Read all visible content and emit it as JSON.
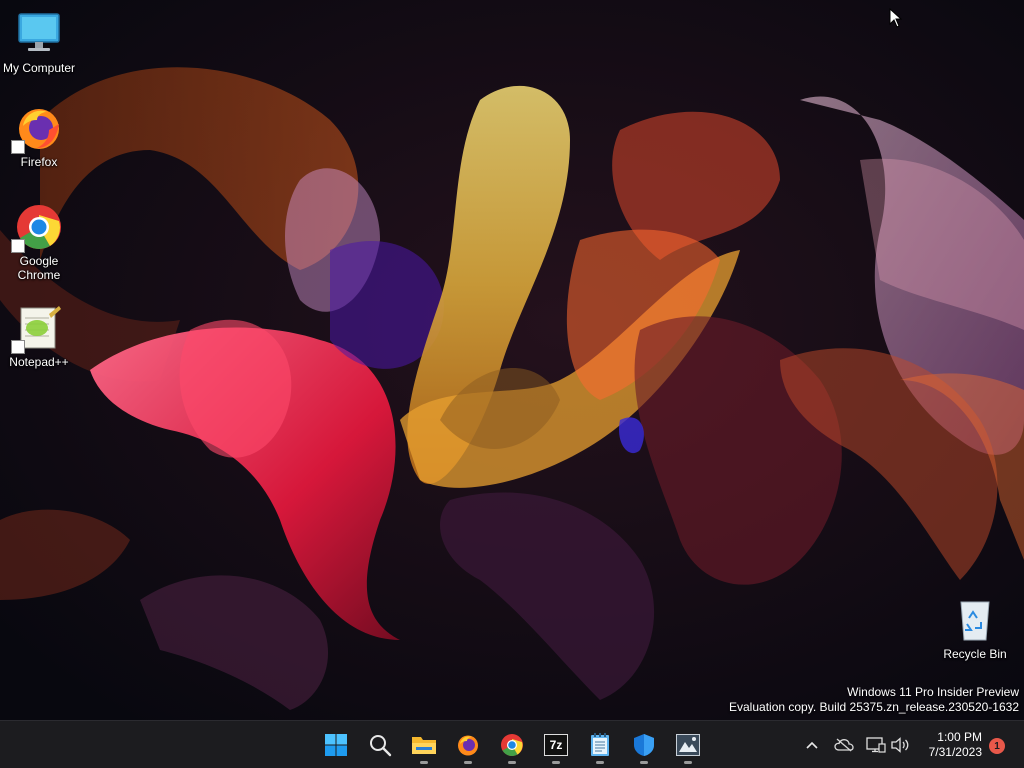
{
  "desktop": {
    "icons": [
      {
        "label": "My Computer"
      },
      {
        "label": "Firefox"
      },
      {
        "label": "Google Chrome"
      },
      {
        "label": "Notepad++"
      }
    ],
    "recycle_bin": {
      "label": "Recycle Bin"
    }
  },
  "watermark": {
    "line1": "Windows 11 Pro Insider Preview",
    "line2": "Evaluation copy. Build 25375.zn_release.230520-1632"
  },
  "taskbar": {
    "pinned": [
      {
        "name": "start-icon",
        "running": false
      },
      {
        "name": "search-icon",
        "running": false
      },
      {
        "name": "file-explorer-icon",
        "running": true
      },
      {
        "name": "firefox-icon",
        "running": true
      },
      {
        "name": "chrome-icon",
        "running": true
      },
      {
        "name": "7zip-icon",
        "running": true
      },
      {
        "name": "notepad-icon",
        "running": true
      },
      {
        "name": "windows-security-icon",
        "running": true
      },
      {
        "name": "app-icon",
        "running": true
      }
    ],
    "seven_zip_label": "7z",
    "clock": {
      "time": "1:00 PM",
      "date": "7/31/2023"
    },
    "notification_count": "1"
  },
  "colors": {
    "taskbar": "#1c1c1f",
    "accent": "#0078d4",
    "badge": "#e8584a"
  }
}
